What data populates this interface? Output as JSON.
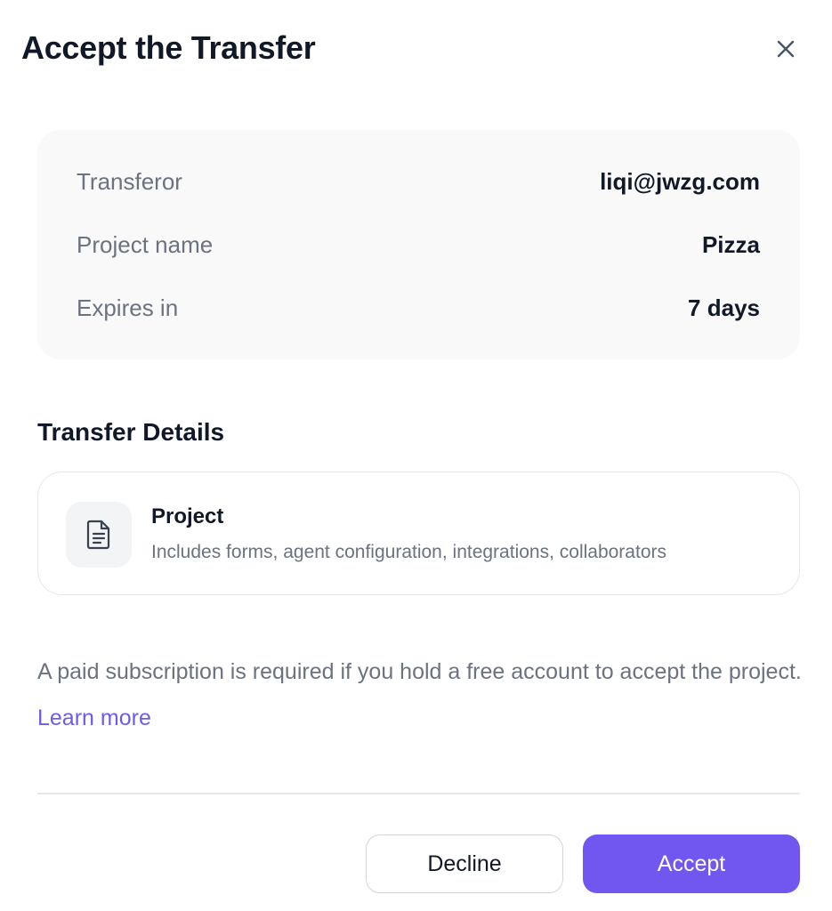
{
  "dialog": {
    "title": "Accept the Transfer",
    "close_icon": "close-icon"
  },
  "summary": {
    "rows": [
      {
        "label": "Transferor",
        "value": "liqi@jwzg.com"
      },
      {
        "label": "Project name",
        "value": "Pizza"
      },
      {
        "label": "Expires in",
        "value": "7 days"
      }
    ]
  },
  "details": {
    "heading": "Transfer Details",
    "item": {
      "icon": "document-icon",
      "title": "Project",
      "description": "Includes forms, agent configuration, integrations, collaborators"
    }
  },
  "notice": {
    "text": "A paid subscription is required if you hold a free account to accept the project.",
    "link_label": "Learn more"
  },
  "actions": {
    "decline_label": "Decline",
    "accept_label": "Accept"
  },
  "colors": {
    "accent": "#7156f0",
    "link": "#6d5ce8",
    "muted_text": "#6b7280",
    "panel_bg": "#f9f9fa"
  }
}
